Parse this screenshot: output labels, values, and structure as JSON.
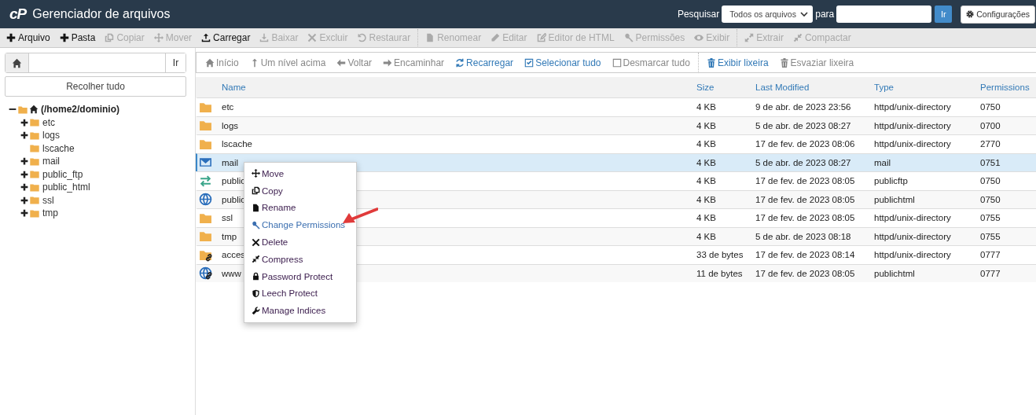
{
  "header": {
    "logo": "cP",
    "title": "Gerenciador de arquivos",
    "search_label": "Pesquisar",
    "search_scope": "Todos os arquivos",
    "for_label": "para",
    "go_button": "Ir",
    "settings_button": "Configurações"
  },
  "toolbar": [
    [
      {
        "label": "Arquivo",
        "disabled": false
      },
      {
        "label": "Pasta",
        "disabled": false
      },
      {
        "label": "Copiar",
        "disabled": true
      },
      {
        "label": "Mover",
        "disabled": true
      },
      {
        "label": "Carregar",
        "disabled": false
      },
      {
        "label": "Baixar",
        "disabled": true
      },
      {
        "label": "Excluir",
        "disabled": true
      },
      {
        "label": "Restaurar",
        "disabled": true
      }
    ],
    [
      {
        "label": "Renomear",
        "disabled": true
      },
      {
        "label": "Editar",
        "disabled": true
      },
      {
        "label": "Editor de HTML",
        "disabled": true
      },
      {
        "label": "Permissões",
        "disabled": true
      },
      {
        "label": "Exibir",
        "disabled": true
      }
    ],
    [
      {
        "label": "Extrair",
        "disabled": true
      },
      {
        "label": "Compactar",
        "disabled": true
      }
    ]
  ],
  "path_bar": {
    "go_button": "Ir"
  },
  "collapse_button": "Recolher tudo",
  "tree": {
    "label": "(/home2/dominio)",
    "expanded": true,
    "children": [
      {
        "label": "etc",
        "expandable": true
      },
      {
        "label": "logs",
        "expandable": true
      },
      {
        "label": "lscache",
        "expandable": false
      },
      {
        "label": "mail",
        "expandable": true
      },
      {
        "label": "public_ftp",
        "expandable": true
      },
      {
        "label": "public_html",
        "expandable": true
      },
      {
        "label": "ssl",
        "expandable": true
      },
      {
        "label": "tmp",
        "expandable": true
      }
    ]
  },
  "nav": [
    [
      {
        "label": "Início",
        "disabled": true
      },
      {
        "label": "Um nível acima",
        "disabled": true
      },
      {
        "label": "Voltar",
        "disabled": true
      },
      {
        "label": "Encaminhar",
        "disabled": true
      },
      {
        "label": "Recarregar",
        "disabled": false
      },
      {
        "label": "Selecionar tudo",
        "disabled": false
      },
      {
        "label": "Desmarcar tudo",
        "disabled": true
      }
    ],
    [
      {
        "label": "Exibir lixeira",
        "disabled": false
      },
      {
        "label": "Esvaziar lixeira",
        "disabled": true
      }
    ]
  ],
  "table": {
    "columns": [
      "Name",
      "Size",
      "Last Modified",
      "Type",
      "Permissions"
    ],
    "rows": [
      {
        "kind": "folder",
        "name": "etc",
        "size": "4 KB",
        "modified": "9 de abr. de 2023 23:56",
        "type": "httpd/unix-directory",
        "permissions": "0750",
        "selected": false
      },
      {
        "kind": "folder",
        "name": "logs",
        "size": "4 KB",
        "modified": "5 de abr. de 2023 08:27",
        "type": "httpd/unix-directory",
        "permissions": "0700",
        "selected": false
      },
      {
        "kind": "folder",
        "name": "lscache",
        "size": "4 KB",
        "modified": "17 de fev. de 2023 08:06",
        "type": "httpd/unix-directory",
        "permissions": "2770",
        "selected": false
      },
      {
        "kind": "mail",
        "name": "mail",
        "size": "4 KB",
        "modified": "5 de abr. de 2023 08:27",
        "type": "mail",
        "permissions": "0751",
        "selected": true
      },
      {
        "kind": "ftp",
        "name": "public",
        "size": "4 KB",
        "modified": "17 de fev. de 2023 08:05",
        "type": "publicftp",
        "permissions": "0750",
        "selected": false
      },
      {
        "kind": "web",
        "name": "public",
        "size": "4 KB",
        "modified": "17 de fev. de 2023 08:05",
        "type": "publichtml",
        "permissions": "0750",
        "selected": false
      },
      {
        "kind": "folder",
        "name": "ssl",
        "size": "4 KB",
        "modified": "17 de fev. de 2023 08:05",
        "type": "httpd/unix-directory",
        "permissions": "0755",
        "selected": false
      },
      {
        "kind": "folder",
        "name": "tmp",
        "size": "4 KB",
        "modified": "5 de abr. de 2023 08:18",
        "type": "httpd/unix-directory",
        "permissions": "0755",
        "selected": false
      },
      {
        "kind": "folder-link",
        "name": "acces",
        "size": "33 de bytes",
        "modified": "17 de fev. de 2023 08:14",
        "type": "httpd/unix-directory",
        "permissions": "0777",
        "selected": false
      },
      {
        "kind": "web-link",
        "name": "www",
        "size": "11 de bytes",
        "modified": "17 de fev. de 2023 08:05",
        "type": "publichtml",
        "permissions": "0777",
        "selected": false
      }
    ]
  },
  "context_menu": [
    {
      "label": "Move",
      "selected": false
    },
    {
      "label": "Copy",
      "selected": false
    },
    {
      "label": "Rename",
      "selected": false
    },
    {
      "label": "Change Permissions",
      "selected": true
    },
    {
      "label": "Delete",
      "selected": false
    },
    {
      "label": "Compress",
      "selected": false
    },
    {
      "label": "Password Protect",
      "selected": false
    },
    {
      "label": "Leech Protect",
      "selected": false
    },
    {
      "label": "Manage Indices",
      "selected": false
    }
  ]
}
